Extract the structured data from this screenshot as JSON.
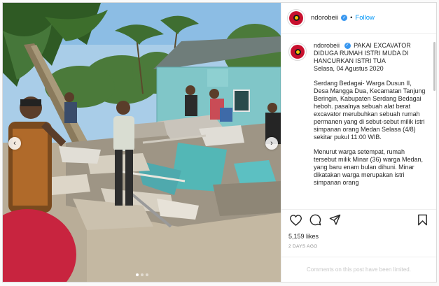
{
  "post": {
    "username": "ndorobeii",
    "follow_label": "Follow",
    "separator": "•",
    "verified_mark": "✓",
    "caption": {
      "username": "ndorobeii",
      "headline": "PAKAI EXCAVATOR DIDUGA RUMAH ISTRI MUDA DI HANCURKAN ISTRI TUA",
      "date_line": "Selasa, 04 Agustus 2020",
      "paragraph_1": "Serdang Bedagai- Warga Dusun II, Desa Mangga Dua, Kecamatan Tanjung Beringin, Kabupaten Serdang Bedagai heboh. pasalnya sebuah alat berat excavator merubuhkan sebuah rumah permanen yang di sebut-sebut milik istri simpanan orang Medan Selasa (4/8) sekitar pukul 11:00 WIB.",
      "paragraph_2": "Menurut warga setempat, rumah tersebut milik Minar (36) warga Medan, yang baru enam bulan dihuni. Minar dikatakan warga merupakan istri simpanan orang"
    },
    "likes": "5,159 likes",
    "timestamp": "2 DAYS AGO",
    "comments_notice": "Comments on this post have been limited.",
    "carousel": {
      "total": 3,
      "active_index": 0
    }
  },
  "icons": {
    "prev": "chevron-left-icon",
    "next": "chevron-right-icon",
    "like": "heart-icon",
    "comment": "comment-icon",
    "share": "paper-plane-icon",
    "save": "bookmark-icon",
    "verified": "verified-badge-icon"
  },
  "colors": {
    "link_blue": "#0095f6",
    "verified_blue": "#3897f0",
    "text": "#262626",
    "muted": "#8e8e8e",
    "house_wall": "#7fc3c6",
    "sky": "#9fc8e6",
    "debris_teal": "#4fb3b5"
  }
}
